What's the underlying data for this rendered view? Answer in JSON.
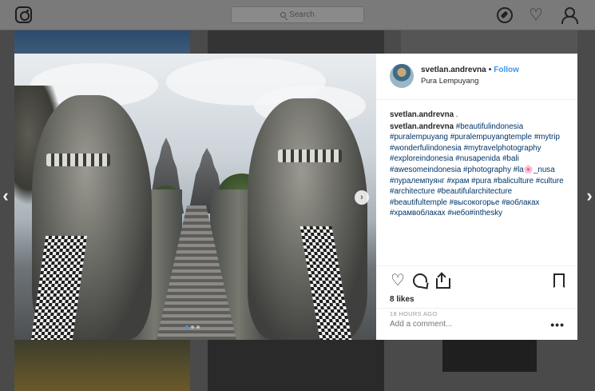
{
  "search": {
    "placeholder": "Search"
  },
  "post": {
    "username": "svetlan.andrevna",
    "separator": "•",
    "follow_label": "Follow",
    "location": "Pura Lempuyang",
    "comments": [
      {
        "user": "svetlan.andrevna",
        "text": " ."
      },
      {
        "user": "svetlan.andrevna",
        "text": " #beautifulindonesia #puralempuyang #puralempuyangtemple #mytrip #wonderfulindonesia #mytravelphotography #exploreindonesia #nusapenida #bali #awesomeindonesia #photography #la🌸_nusa #пуралемпуянг #храм #pura #baliculture #culture #architecture #beautifularchitecture #beautifultemple #высокогорье #вoблаках #храмвоблаках #небо#inthesky"
      }
    ],
    "likes": "8 likes",
    "time": "18 HOURS AGO",
    "add_comment_placeholder": "Add a comment...",
    "more_label": "•••"
  },
  "colors": {
    "accent": "#3897f0",
    "overlay": "#4a4a4a",
    "text": "#262626",
    "muted": "#999999"
  },
  "icons": {
    "logo": "instagram-icon",
    "search": "search-icon",
    "explore": "compass-icon",
    "activity": "heart-icon",
    "profile": "profile-icon",
    "like": "heart-icon",
    "comment": "comment-icon",
    "share": "share-icon",
    "save": "bookmark-icon",
    "prev": "chevron-left-icon",
    "next": "chevron-right-icon"
  },
  "nav": {
    "prev_glyph": "‹",
    "next_glyph": "›",
    "photo_next_glyph": "›",
    "heart_glyph": "♡"
  },
  "carousel": {
    "count": 3,
    "active": 1
  }
}
